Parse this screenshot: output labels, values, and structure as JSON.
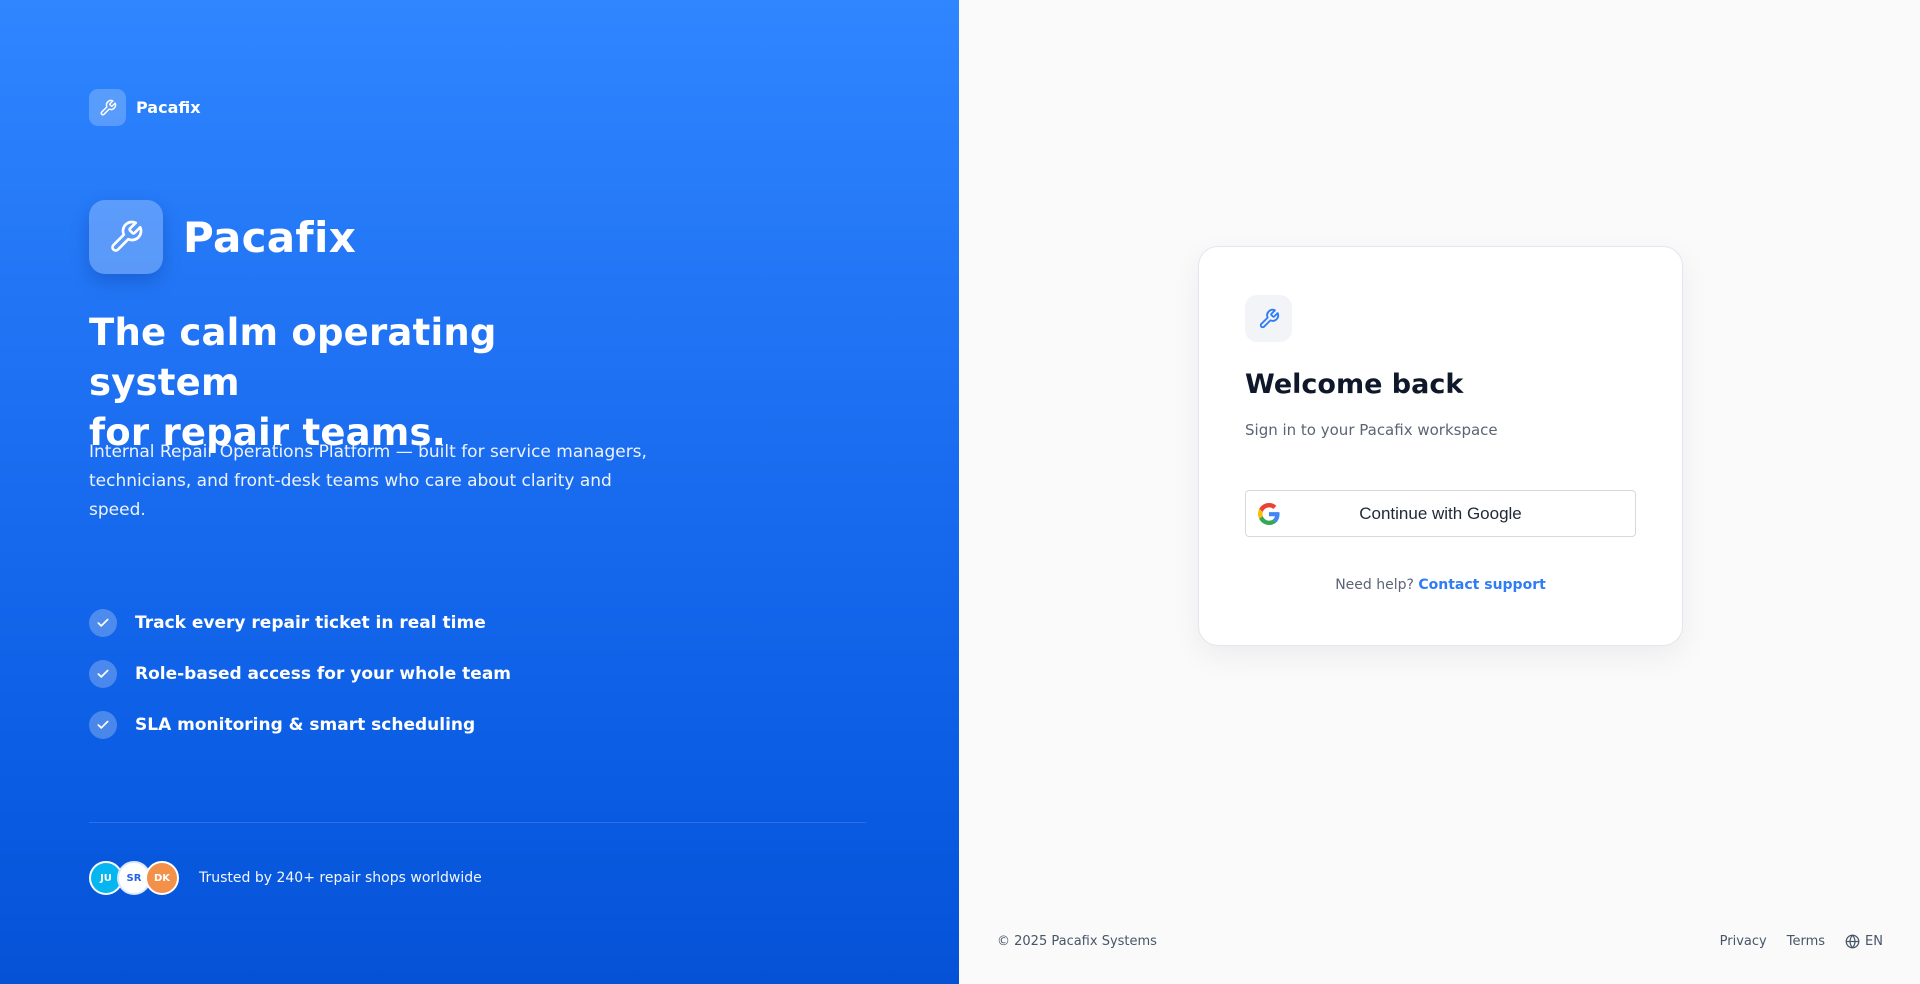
{
  "brand": {
    "name": "Pacafix",
    "accent": "#2f86ff"
  },
  "hero": {
    "headline_line1": "The calm operating system",
    "headline_line2": "for repair teams.",
    "description": "Internal Repair Operations Platform — built for service managers, technicians, and front-desk teams who care about clarity and speed."
  },
  "features": [
    {
      "icon": "check-icon",
      "text": "Track every repair ticket in real time"
    },
    {
      "icon": "check-icon",
      "text": "Role-based access for your whole team"
    },
    {
      "icon": "check-icon",
      "text": "SLA monitoring & smart scheduling"
    }
  ],
  "trust": {
    "avatars": [
      {
        "initials": "JU",
        "color": "#06b6f0"
      },
      {
        "initials": "SR",
        "color": "#ffffff"
      },
      {
        "initials": "DK",
        "color": "#f3914a"
      }
    ],
    "text": "Trusted by 240+ repair shops worldwide"
  },
  "login": {
    "icon": "wrench-icon",
    "title": "Welcome back",
    "subtitle": "Sign in to your Pacafix workspace",
    "google_button": "Continue with Google",
    "help_text": "Need help?",
    "help_link": "Contact support"
  },
  "footer": {
    "copyright": "© 2025 Pacafix Systems",
    "privacy": "Privacy",
    "terms": "Terms",
    "language": "EN"
  }
}
